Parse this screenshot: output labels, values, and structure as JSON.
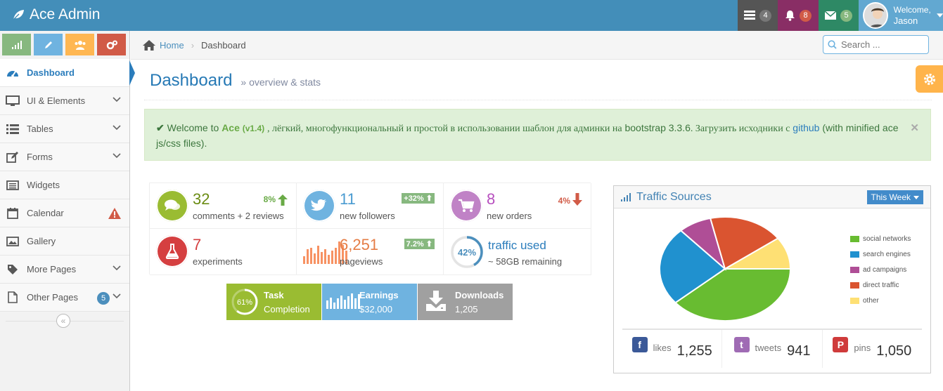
{
  "app": {
    "title": "Ace Admin"
  },
  "navbar": {
    "tasks_count": "4",
    "notifications_count": "8",
    "messages_count": "5",
    "welcome": "Welcome,",
    "user_name": "Jason",
    "colors": {
      "bar": "#438eb9",
      "tasks": "#555555",
      "notifications": "#892e65",
      "messages": "#2e8965",
      "user": "#62a8d1"
    }
  },
  "sidebar": {
    "shortcuts": [
      {
        "icon": "signal-icon",
        "color": "#87b87f"
      },
      {
        "icon": "pencil-icon",
        "color": "#6fb3e0"
      },
      {
        "icon": "users-icon",
        "color": "#ffb752"
      },
      {
        "icon": "cogs-icon",
        "color": "#d15b47"
      }
    ],
    "items": [
      {
        "label": "Dashboard",
        "icon": "tachometer-icon"
      },
      {
        "label": "UI & Elements",
        "icon": "desktop-icon"
      },
      {
        "label": "Tables",
        "icon": "list-icon"
      },
      {
        "label": "Forms",
        "icon": "pencil-square-icon"
      },
      {
        "label": "Widgets",
        "icon": "list-alt-icon"
      },
      {
        "label": "Calendar",
        "icon": "calendar-icon"
      },
      {
        "label": "Gallery",
        "icon": "picture-icon"
      },
      {
        "label": "More Pages",
        "icon": "tag-icon"
      },
      {
        "label": "Other Pages",
        "icon": "file-icon",
        "badge": "5"
      }
    ]
  },
  "breadcrumbs": {
    "home": "Home",
    "current": "Dashboard"
  },
  "search": {
    "placeholder": "Search ..."
  },
  "page_header": {
    "title": "Dashboard",
    "subtitle": "overview & stats"
  },
  "alert": {
    "prefix": "Welcome to",
    "brand": "Ace",
    "version": "(v1.4)",
    "text1": ", лёгкий, многофункциональный и простой в использовании шаблон для админки на",
    "bootstrap": "bootstrap 3.3.6",
    "text2": ". Загрузить исходники с",
    "github": "github",
    "text3": "(with minified ace js/css files)."
  },
  "infoboxes": [
    {
      "number": "32",
      "text": "comments + 2 reviews",
      "stat": "8%",
      "color": "#9abc32",
      "icon": "comments-icon"
    },
    {
      "number": "11",
      "text": "new followers",
      "stat": "+32%",
      "color": "#6fb3e0",
      "icon": "twitter-icon"
    },
    {
      "number": "8",
      "text": "new orders",
      "stat": "4%",
      "color": "#c082c6",
      "icon": "shopping-cart-icon"
    },
    {
      "number": "7",
      "text": "experiments",
      "color": "#d53f40",
      "icon": "flask-icon"
    },
    {
      "number": "6,251",
      "text": "pageviews",
      "stat": "7.2%",
      "color": "#f79263",
      "sparkline": [
        10,
        20,
        22,
        14,
        24,
        16,
        20,
        12,
        18,
        22,
        30,
        25,
        18
      ]
    },
    {
      "number": "traffic used",
      "text": "~ 58GB remaining",
      "percent": "42%",
      "percent_value": 42,
      "color": "#4c8fbd"
    }
  ],
  "dark_infoboxes": [
    {
      "percent": "61%",
      "percent_value": 61,
      "title": "Task",
      "subtitle": "Completion",
      "color": "#9abc32"
    },
    {
      "title": "Earnings",
      "subtitle": "$32,000",
      "color": "#6fb3e0",
      "bars": [
        8,
        11,
        6,
        10,
        13,
        9,
        12,
        15,
        10,
        14
      ]
    },
    {
      "title": "Downloads",
      "subtitle": "1,205",
      "color": "#a0a0a0",
      "icon": "download-icon"
    }
  ],
  "traffic": {
    "title": "Traffic Sources",
    "period": "This Week",
    "chart_data": {
      "type": "pie",
      "categories": [
        "social networks",
        "search engines",
        "ad campaigns",
        "direct traffic",
        "other"
      ],
      "values": [
        38.7,
        24.5,
        8.2,
        18.6,
        10
      ],
      "colors": [
        "#68bc31",
        "#2091cf",
        "#af4e96",
        "#da5430",
        "#fee074"
      ]
    }
  },
  "social": [
    {
      "label": "likes",
      "value": "1,255",
      "icon": "facebook-icon",
      "color": "#3b5998",
      "glyph": "f"
    },
    {
      "label": "tweets",
      "value": "941",
      "icon": "twitter-square-icon",
      "color": "#9f6bb4",
      "glyph": "t"
    },
    {
      "label": "pins",
      "value": "1,050",
      "icon": "pinterest-icon",
      "color": "#cf3b3b",
      "glyph": "P"
    }
  ]
}
